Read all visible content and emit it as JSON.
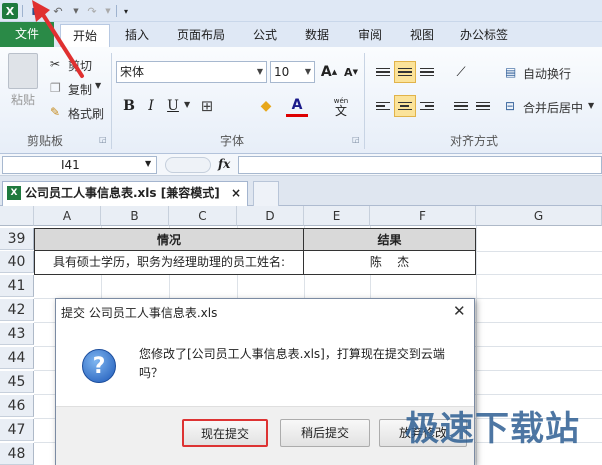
{
  "toolbar": {
    "app_icon": "excel-icon",
    "logo_letter": "X",
    "save_icon": "save-icon",
    "undo_icon": "undo-icon",
    "redo_icon": "redo-icon",
    "customize_icon": "customize-icon"
  },
  "tabs": [
    {
      "label": "文件"
    },
    {
      "label": "开始"
    },
    {
      "label": "插入"
    },
    {
      "label": "页面布局"
    },
    {
      "label": "公式"
    },
    {
      "label": "数据"
    },
    {
      "label": "审阅"
    },
    {
      "label": "视图"
    },
    {
      "label": "办公标签"
    }
  ],
  "ribbon": {
    "clipboard": {
      "paste": "粘贴",
      "cut": "剪切",
      "copy": "复制",
      "format_painter": "格式刷",
      "group_label": "剪贴板"
    },
    "font": {
      "font_name": "宋体",
      "font_size": "10",
      "bold": "B",
      "italic": "I",
      "underline": "U",
      "font_color_letter": "A",
      "wen": "wén",
      "wen_char": "文",
      "group_label": "字体"
    },
    "alignment": {
      "wrap_text": "自动换行",
      "merge_center": "合并后居中",
      "group_label": "对齐方式"
    }
  },
  "formula_bar": {
    "name_box": "I41",
    "fx": "fx"
  },
  "document_tab": {
    "label": "公司员工人事信息表.xls  [兼容模式]",
    "close": "×"
  },
  "sheet": {
    "columns": [
      "A",
      "B",
      "C",
      "D",
      "E",
      "F",
      "G"
    ],
    "rows": [
      "39",
      "40",
      "41",
      "42",
      "43",
      "44",
      "45",
      "46",
      "47",
      "48"
    ],
    "row39": {
      "header_situation": "情况",
      "header_result": "结果"
    },
    "row40": {
      "label": "具有硕士学历，职务为经理助理的员工姓名:",
      "value": "陈    杰"
    }
  },
  "dialog": {
    "title": "提交 公司员工人事信息表.xls",
    "close": "✕",
    "icon": "question-icon",
    "icon_glyph": "?",
    "message": "您修改了[公司员工人事信息表.xls]，打算现在提交到云端吗？",
    "buttons": {
      "submit_now": "现在提交",
      "submit_later": "稍后提交",
      "discard": "放弃修改"
    }
  },
  "watermark": "极速下载站",
  "colors": {
    "file_tab": "#2a8a47",
    "highlight_border": "#dd3333",
    "accent_blue": "#1c58b8"
  }
}
